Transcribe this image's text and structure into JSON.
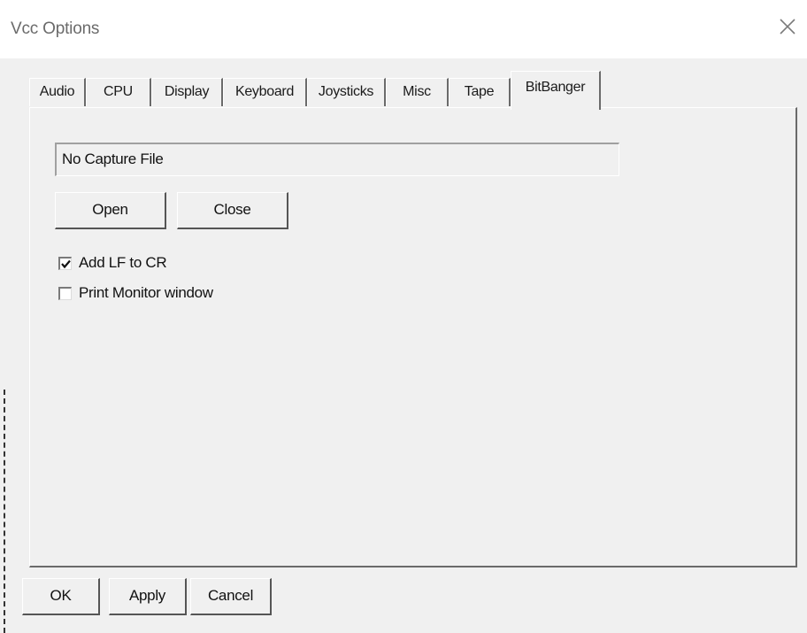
{
  "window": {
    "title": "Vcc Options"
  },
  "tabs": [
    {
      "label": "Audio"
    },
    {
      "label": "CPU"
    },
    {
      "label": "Display"
    },
    {
      "label": "Keyboard"
    },
    {
      "label": "Joysticks"
    },
    {
      "label": "Misc"
    },
    {
      "label": "Tape"
    },
    {
      "label": "BitBanger",
      "active": true
    }
  ],
  "bitbanger": {
    "capture_file": "No Capture File",
    "open_label": "Open",
    "close_label": "Close",
    "add_lf_label": "Add LF to CR",
    "add_lf_checked": true,
    "print_monitor_label": "Print Monitor window",
    "print_monitor_checked": false
  },
  "footer": {
    "ok_label": "OK",
    "apply_label": "Apply",
    "cancel_label": "Cancel"
  },
  "icons": {
    "close": "close-icon",
    "check": "checkmark-icon"
  }
}
